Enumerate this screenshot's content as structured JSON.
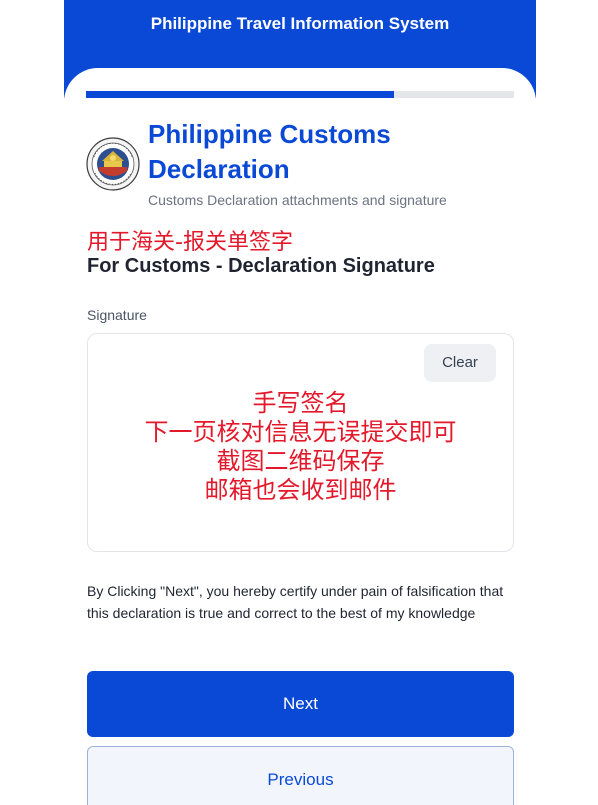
{
  "header": {
    "title": "Philippine Travel Information System"
  },
  "progress": {
    "fraction": 0.72
  },
  "form": {
    "title": "Philippine Customs Declaration",
    "subtitle": "Customs Declaration attachments and signature",
    "seal_icon": "bureau-of-customs-seal"
  },
  "annotation": {
    "cn_heading": "用于海关-报关单签字",
    "en_heading": "For Customs - Declaration Signature",
    "note_lines": [
      "手写签名",
      "下一页核对信息无误提交即可",
      "截图二维码保存",
      "邮箱也会收到邮件"
    ]
  },
  "signature": {
    "label": "Signature",
    "clear_label": "Clear"
  },
  "certification": {
    "text": "By Clicking \"Next\", you hereby certify under pain of falsification that this declaration is true and correct to the best of my knowledge"
  },
  "buttons": {
    "next_label": "Next",
    "previous_label": "Previous"
  },
  "colors": {
    "brand_blue": "#0a49d6",
    "annotation_red": "#e3192b"
  }
}
